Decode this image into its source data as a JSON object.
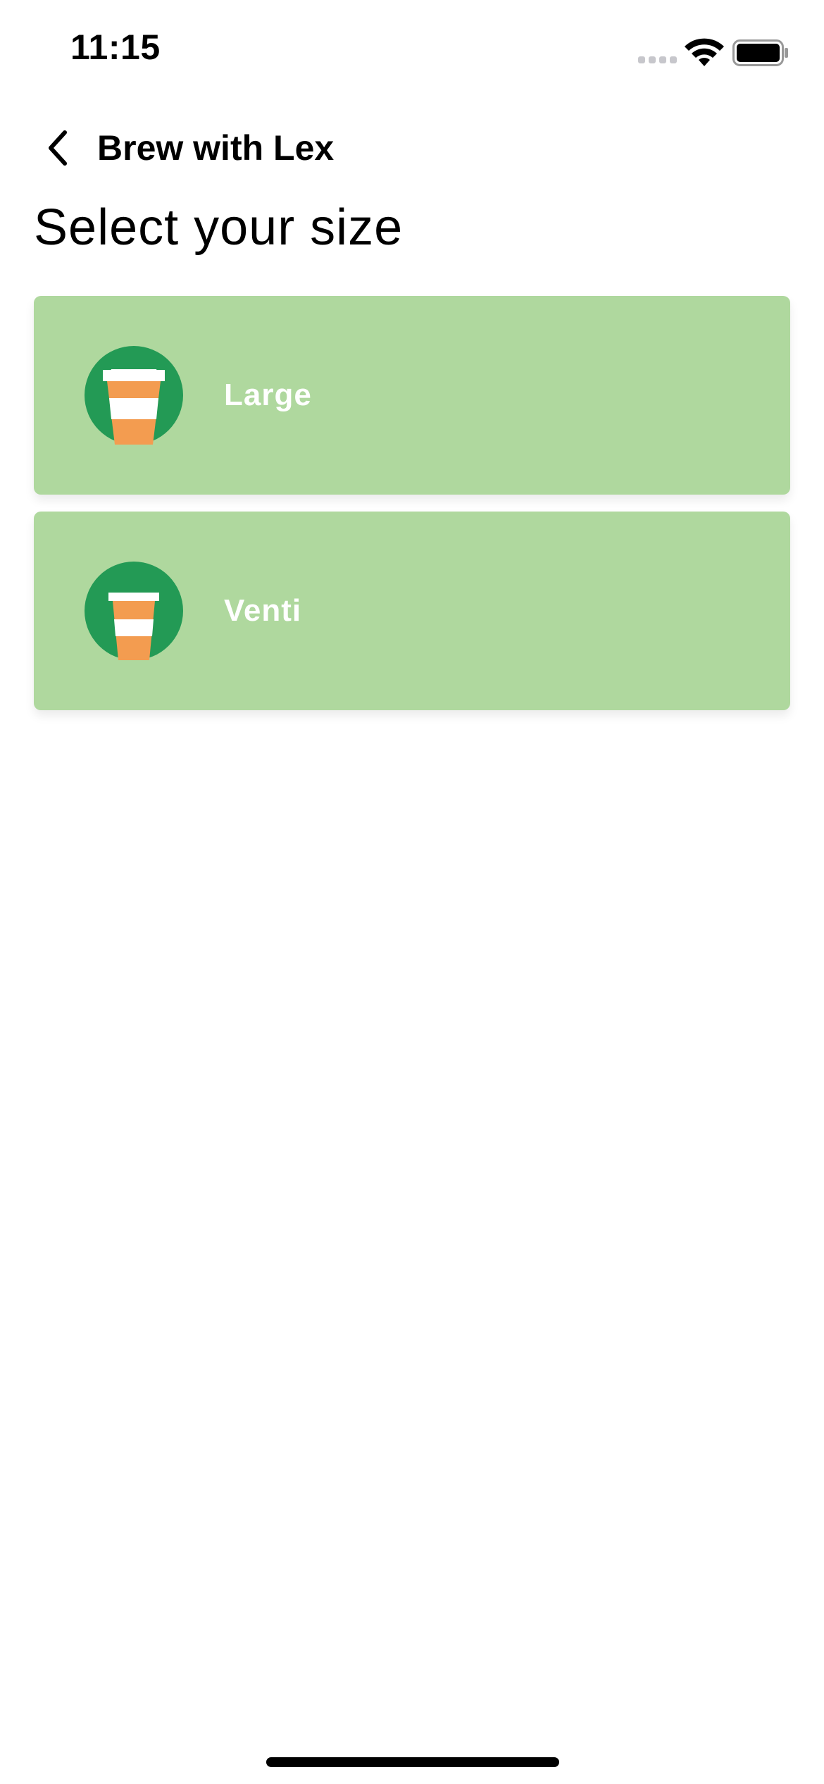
{
  "status_bar": {
    "time": "11:15"
  },
  "nav": {
    "back_icon": "chevron-left-icon",
    "title": "Brew with Lex"
  },
  "heading": "Select your size",
  "options": [
    {
      "label": "Large",
      "icon": "coffee-cup-icon"
    },
    {
      "label": "Venti",
      "icon": "coffee-cup-icon"
    }
  ],
  "colors": {
    "card_background": "#afd89e",
    "icon_circle": "#239a55",
    "cup_orange": "#f39c50",
    "label_text": "#ffffff"
  }
}
